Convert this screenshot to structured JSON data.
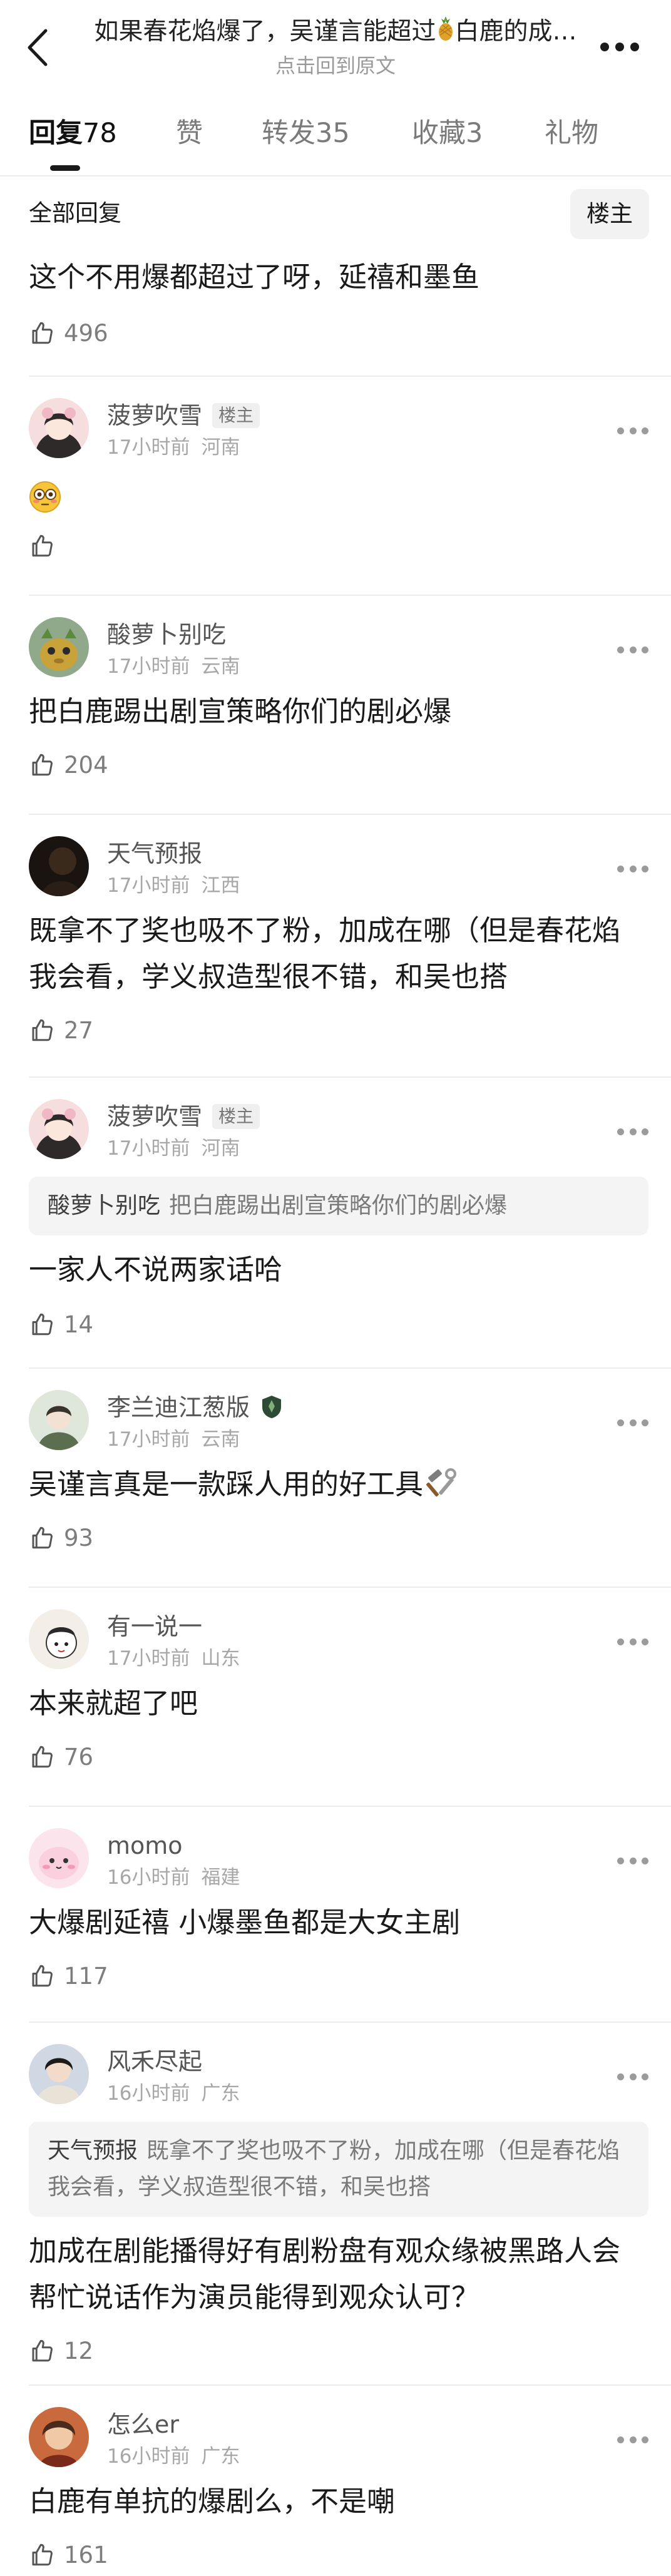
{
  "header": {
    "title_before": "如果春花焰爆了，吴谨言能超过",
    "title_after": "白鹿的成…",
    "subtitle": "点击回到原文",
    "pineapple_icon": "pineapple-icon"
  },
  "tabs": [
    {
      "label": "回复",
      "count": "78"
    },
    {
      "label": "赞",
      "count": ""
    },
    {
      "label": "转发",
      "count": "35"
    },
    {
      "label": "收藏",
      "count": "3"
    },
    {
      "label": "礼物",
      "count": ""
    }
  ],
  "filter": {
    "label": "全部回复",
    "owner_button": "楼主"
  },
  "top_comment": {
    "text": "这个不用爆都超过了呀，延禧和墨鱼",
    "likes": "496"
  },
  "comments": [
    {
      "name": "菠萝吹雪",
      "badge": "楼主",
      "time": "17小时前",
      "location": "河南",
      "emoji": "flushed-face-emoji",
      "text": "",
      "likes": ""
    },
    {
      "name": "酸萝卜别吃",
      "time": "17小时前",
      "location": "云南",
      "text": "把白鹿踢出剧宣策略你们的剧必爆",
      "likes": "204"
    },
    {
      "name": "天气预报",
      "time": "17小时前",
      "location": "江西",
      "text": "既拿不了奖也吸不了粉，加成在哪（但是春花焰我会看，学义叔造型很不错，和吴也搭",
      "likes": "27"
    },
    {
      "name": "菠萝吹雪",
      "badge": "楼主",
      "time": "17小时前",
      "location": "河南",
      "quote_name": "酸萝卜别吃",
      "quote_text": "把白鹿踢出剧宣策略你们的剧必爆",
      "text": "一家人不说两家话哈",
      "likes": "14"
    },
    {
      "name": "李兰迪江葱版",
      "time": "17小时前",
      "location": "云南",
      "text": "吴谨言真是一款踩人用的好工具",
      "likes": "93"
    },
    {
      "name": "有一说一",
      "time": "17小时前",
      "location": "山东",
      "text": "本来就超了吧",
      "likes": "76"
    },
    {
      "name": "momo",
      "time": "16小时前",
      "location": "福建",
      "text": "大爆剧延禧 小爆墨鱼都是大女主剧",
      "likes": "117"
    },
    {
      "name": "风禾尽起",
      "time": "16小时前",
      "location": "广东",
      "quote_name": "天气预报",
      "quote_text": "既拿不了奖也吸不了粉，加成在哪（但是春花焰我会看，学义叔造型很不错，和吴也搭",
      "text": "加成在剧能播得好有剧粉盘有观众缘被黑路人会帮忙说话作为演员能得到观众认可？",
      "likes": "12"
    },
    {
      "name": "怎么er",
      "time": "16小时前",
      "location": "广东",
      "text": "白鹿有单抗的爆剧么，不是嘲",
      "likes": "161"
    }
  ],
  "colors": {
    "text_primary": "#1a1a1a",
    "text_secondary": "#555555",
    "text_meta": "#a7a7a7",
    "quote_bg": "#f4f4f4",
    "divider": "#ececec"
  }
}
